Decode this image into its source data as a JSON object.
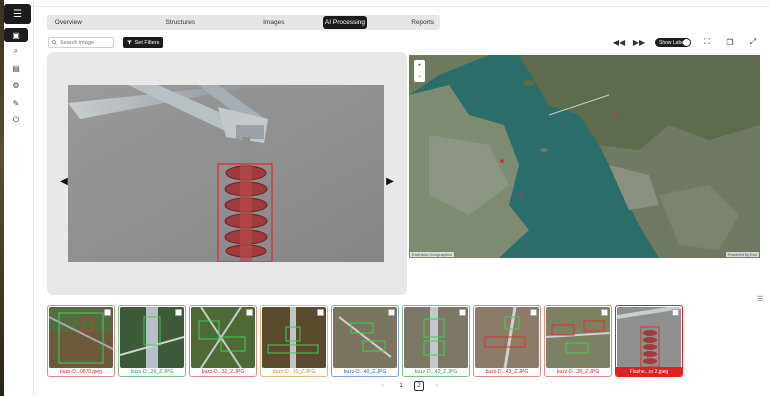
{
  "sidebar": {
    "items": [
      {
        "icon": "dashboard-icon",
        "active": true
      },
      {
        "icon": "search-icon"
      },
      {
        "icon": "chart-icon"
      },
      {
        "icon": "settings-icon"
      },
      {
        "icon": "wrench-icon"
      },
      {
        "icon": "logout-icon"
      }
    ]
  },
  "tabs": [
    {
      "label": "Overview"
    },
    {
      "label": "Structures"
    },
    {
      "label": "Images"
    },
    {
      "label": "AI Processing",
      "active": true
    },
    {
      "label": "Reports"
    }
  ],
  "toolbar": {
    "search_placeholder": "Search image",
    "filter_label": "Set Filters",
    "show_labels": "Show Labels"
  },
  "map": {
    "credit_left": "Earthstar Geographics",
    "credit_right": "Powered by Esri",
    "zoom_in": "+",
    "zoom_out": "−"
  },
  "thumbnails": [
    {
      "caption": "buzz-D...0870.jpeg",
      "status": "red"
    },
    {
      "caption": "buzz-D...29_Z.JPG",
      "status": "green"
    },
    {
      "caption": "buzz-D...32_Z.JPG",
      "status": "red"
    },
    {
      "caption": "buzz-D...15_Z.JPG",
      "status": "orange"
    },
    {
      "caption": "buzz-D...40_Z.JPG",
      "status": "blue"
    },
    {
      "caption": "buzz-D...42_Z.JPG",
      "status": "green"
    },
    {
      "caption": "buzz-D...43_Z.JPG",
      "status": "red"
    },
    {
      "caption": "buzz-D...39_Z.JPG",
      "status": "red"
    },
    {
      "caption": "Flashe...or 2.jpeg",
      "status": "selected"
    }
  ],
  "pagination": {
    "prev": "‹",
    "pages": [
      "1",
      "2"
    ],
    "current": "2",
    "next": "›"
  },
  "colors": {
    "accent": "#1c1c1c",
    "alert": "#e22020",
    "ok": "#2f9e48"
  }
}
